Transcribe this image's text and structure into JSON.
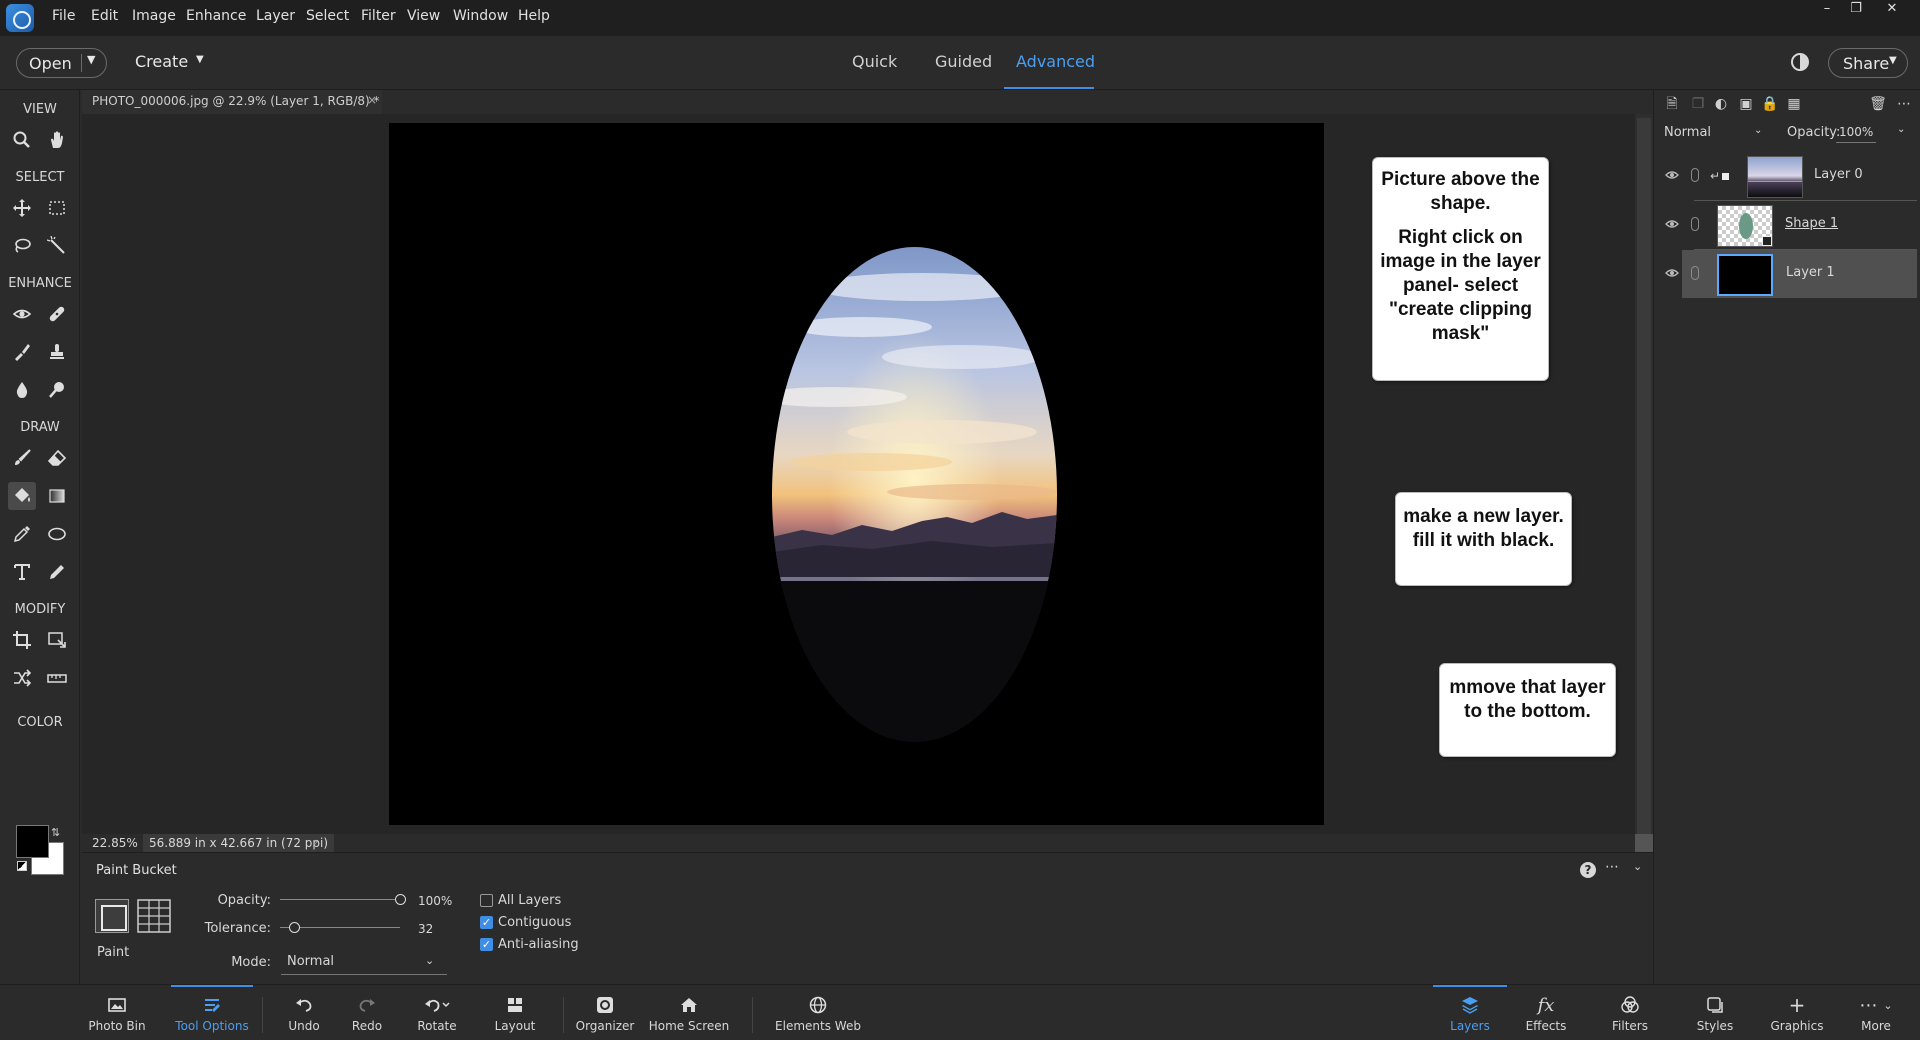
{
  "menubar": {
    "items": [
      "File",
      "Edit",
      "Image",
      "Enhance",
      "Layer",
      "Select",
      "Filter",
      "View",
      "Window",
      "Help"
    ]
  },
  "topbar": {
    "open_label": "Open",
    "create_label": "Create",
    "modes": [
      "Quick",
      "Guided",
      "Advanced"
    ],
    "active_mode": "Advanced",
    "share_label": "Share"
  },
  "toolbox": {
    "sections": {
      "view": "VIEW",
      "select": "SELECT",
      "enhance": "ENHANCE",
      "draw": "DRAW",
      "modify": "MODIFY",
      "color": "COLOR"
    },
    "active_tool": "paint-bucket",
    "foreground_color": "#000000",
    "background_color": "#ffffff"
  },
  "document": {
    "tab_title": "PHOTO_000006.jpg @ 22.9% (Layer 1, RGB/8) *",
    "zoom": "22.85%",
    "size_info": "56.889 in x 42.667 in (72 ppi)"
  },
  "callouts": {
    "first": {
      "line1": "Picture above the shape.",
      "line2": "Right click on image in the layer panel- select \"create clipping mask\""
    },
    "second": "make a new layer.  fill it with black.",
    "third": "mmove that layer to the bottom."
  },
  "tool_options": {
    "title": "Paint Bucket",
    "fill_label": "Paint",
    "opacity_label": "Opacity:",
    "opacity_value": "100%",
    "opacity_fraction": 1.0,
    "tolerance_label": "Tolerance:",
    "tolerance_value": "32",
    "tolerance_fraction": 0.12,
    "mode_label": "Mode:",
    "mode_value": "Normal",
    "checkboxes": [
      {
        "label": "All Layers",
        "checked": false
      },
      {
        "label": "Contiguous",
        "checked": true
      },
      {
        "label": "Anti-aliasing",
        "checked": true
      }
    ],
    "help_glyph": "?"
  },
  "layers_panel": {
    "blend_mode": "Normal",
    "opacity_label": "Opacity:",
    "opacity_value": "100%",
    "layers": [
      {
        "name": "Layer 0",
        "selected": false
      },
      {
        "name": "Shape 1",
        "selected": false
      },
      {
        "name": "Layer 1",
        "selected": true
      }
    ]
  },
  "taskbar": {
    "left": [
      {
        "label": "Photo Bin",
        "icon": "photo-bin-icon"
      },
      {
        "label": "Tool Options",
        "icon": "tool-options-icon",
        "active": true
      },
      {
        "label": "Undo",
        "icon": "undo-icon"
      },
      {
        "label": "Redo",
        "icon": "redo-icon"
      },
      {
        "label": "Rotate",
        "icon": "rotate-icon"
      },
      {
        "label": "Layout",
        "icon": "layout-icon"
      },
      {
        "label": "Organizer",
        "icon": "organizer-icon"
      },
      {
        "label": "Home Screen",
        "icon": "home-icon"
      },
      {
        "label": "Elements Web",
        "icon": "globe-icon"
      }
    ],
    "right": [
      {
        "label": "Layers",
        "icon": "layers-icon",
        "active": true
      },
      {
        "label": "Effects",
        "icon": "effects-icon"
      },
      {
        "label": "Filters",
        "icon": "filters-icon"
      },
      {
        "label": "Styles",
        "icon": "styles-icon"
      },
      {
        "label": "Graphics",
        "icon": "graphics-icon"
      },
      {
        "label": "More",
        "icon": "more-icon"
      }
    ]
  },
  "colors": {
    "accent": "#3f8de4",
    "panel_bg": "#2b2b2b",
    "menubar_bg": "#1f1f1f"
  }
}
